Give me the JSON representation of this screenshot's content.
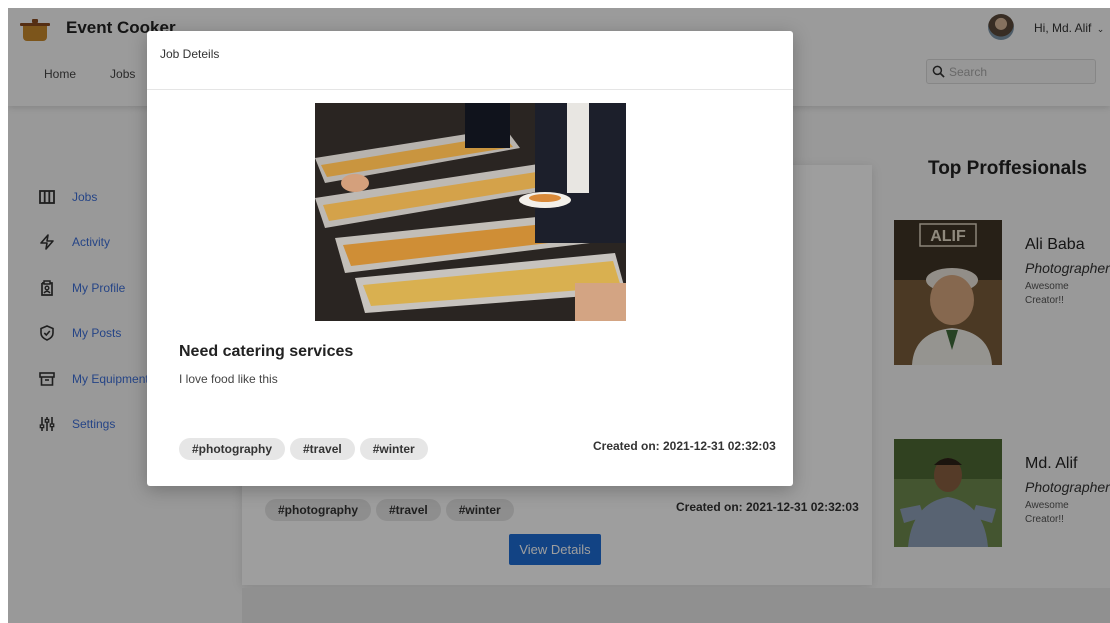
{
  "app": {
    "brand": "Event Cooker"
  },
  "header": {
    "nav": [
      "Home",
      "Jobs"
    ],
    "greeting": "Hi, Md. Alif",
    "search_placeholder": "Search"
  },
  "sidebar": {
    "items": [
      {
        "label": "Jobs",
        "icon": "columns-icon"
      },
      {
        "label": "Activity",
        "icon": "activity-icon"
      },
      {
        "label": "My Profile",
        "icon": "profile-icon"
      },
      {
        "label": "My Posts",
        "icon": "shield-icon"
      },
      {
        "label": "My Equipment",
        "icon": "archive-icon"
      },
      {
        "label": "Settings",
        "icon": "sliders-icon"
      }
    ]
  },
  "background_card": {
    "tags": [
      "#photography",
      "#travel",
      "#winter"
    ],
    "created": "Created on: 2021-12-31 02:32:03",
    "view_details": "View Details"
  },
  "top_professionals": {
    "title": "Top Proffesionals",
    "people": [
      {
        "name": "Ali Baba",
        "role": "Photographer",
        "desc": "Awesome Creator!!",
        "photo_text": "ALIF"
      },
      {
        "name": "Md. Alif",
        "role": "Photographer",
        "desc": "Awesome Creator!!"
      }
    ]
  },
  "modal": {
    "header": "Job Deteils",
    "title": "Need catering services",
    "description": "I love food like this",
    "tags": [
      "#photography",
      "#travel",
      "#winter"
    ],
    "created": "Created on: 2021-12-31 02:32:03"
  },
  "colors": {
    "accent": "#1d6dd6",
    "link": "#3d6fd9",
    "overlay": "rgba(0,0,0,0.38)"
  }
}
